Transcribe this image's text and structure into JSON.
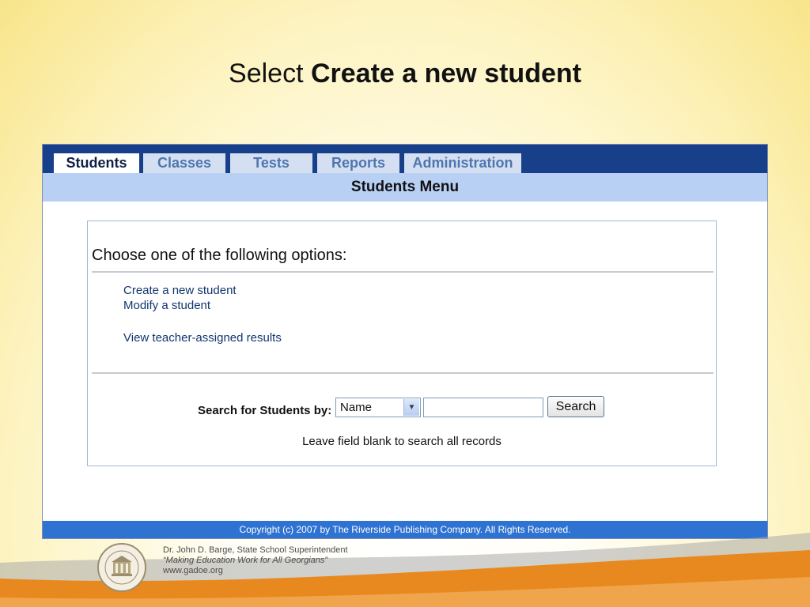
{
  "slide": {
    "title_prefix": "Select ",
    "title_bold": "Create a new student"
  },
  "tabs": [
    {
      "label": "Students",
      "active": true
    },
    {
      "label": "Classes",
      "active": false
    },
    {
      "label": "Tests",
      "active": false
    },
    {
      "label": "Reports",
      "active": false
    },
    {
      "label": "Administration",
      "active": false
    }
  ],
  "submenu": {
    "title": "Students Menu"
  },
  "panel": {
    "heading": "Choose one of the following options:",
    "links": [
      "Create a new student",
      "Modify a student",
      "View teacher-assigned results"
    ]
  },
  "search": {
    "label": "Search for Students by:",
    "selected": "Name",
    "input_value": "",
    "button": "Search",
    "hint": "Leave field blank to search all records"
  },
  "footer": {
    "copyright": "Copyright (c) 2007 by The Riverside Publishing Company. All Rights Reserved."
  },
  "credits": {
    "line1": "Dr. John D. Barge, State School Superintendent",
    "line2": "“Making Education Work for All Georgians”",
    "line3": "www.gadoe.org"
  },
  "colors": {
    "tabbar": "#173f8a",
    "submenu": "#b9d0f5",
    "footer": "#2f73d2",
    "link": "#12356e",
    "swoosh": "#e8891f"
  }
}
